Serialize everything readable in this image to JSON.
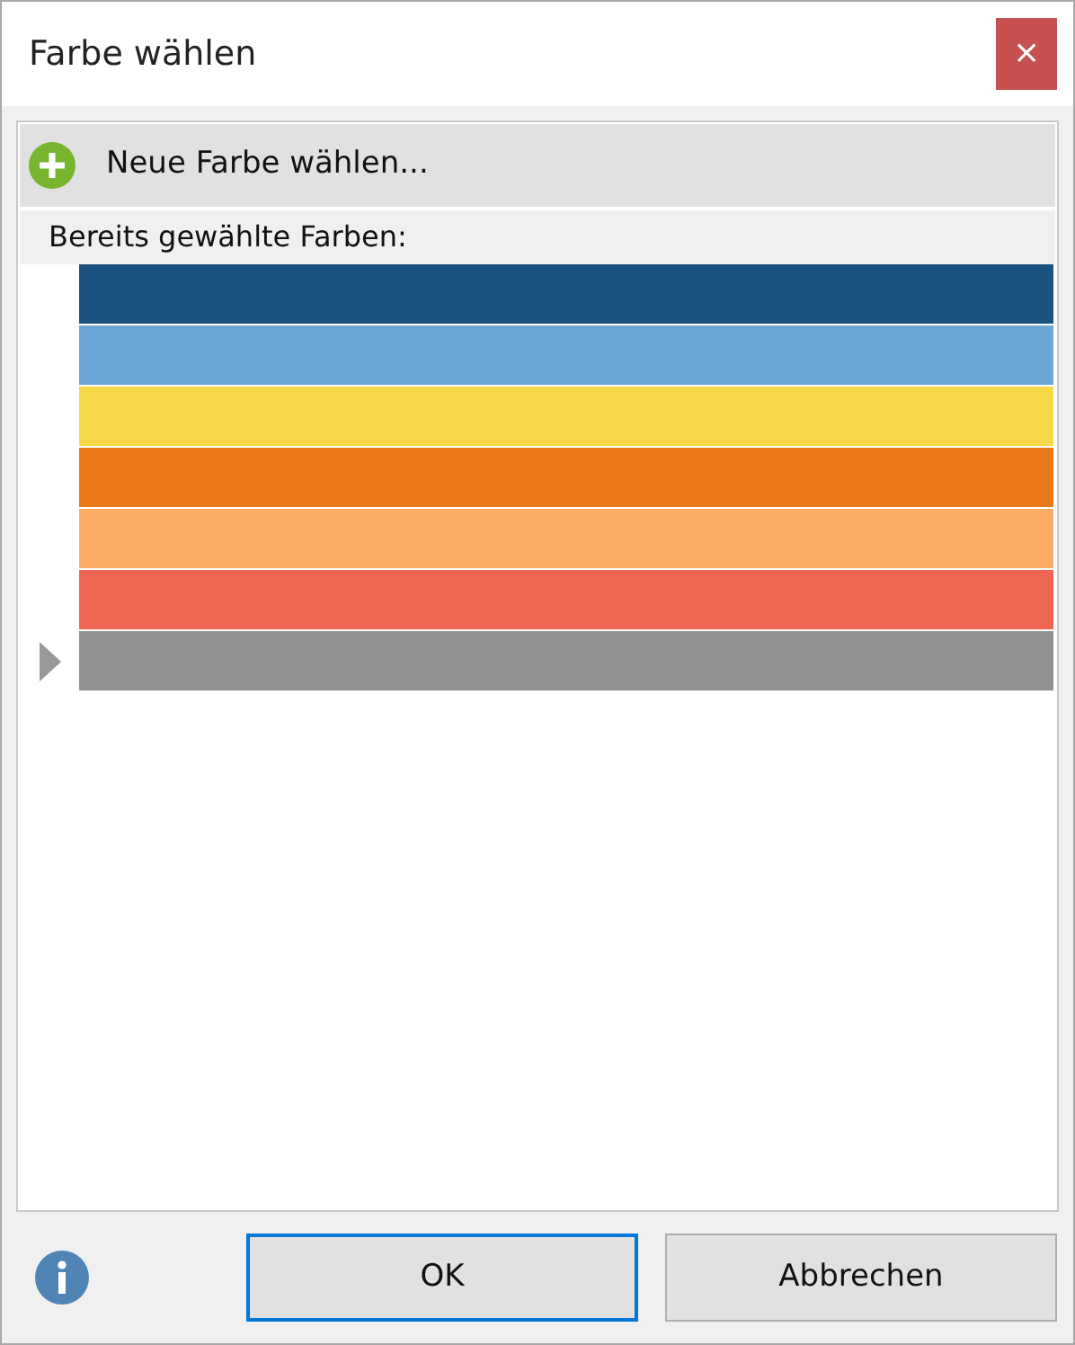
{
  "window": {
    "title": "Farbe wählen",
    "close_glyph": "×"
  },
  "new_color": {
    "label": "Neue Farbe wählen..."
  },
  "section_label": "Bereits gewählte Farben:",
  "colors": [
    {
      "color": "#1c5280",
      "selected": false
    },
    {
      "color": "#6ca6d5",
      "selected": false
    },
    {
      "color": "#f8d848",
      "selected": false
    },
    {
      "color": "#ea7816",
      "selected": false
    },
    {
      "color": "#fbac65",
      "selected": false
    },
    {
      "color": "#ee6551",
      "selected": false
    },
    {
      "color": "#919191",
      "selected": true
    }
  ],
  "buttons": [
    {
      "label": "OK",
      "focused": true
    },
    {
      "label": "Abbrechen",
      "focused": false
    }
  ]
}
